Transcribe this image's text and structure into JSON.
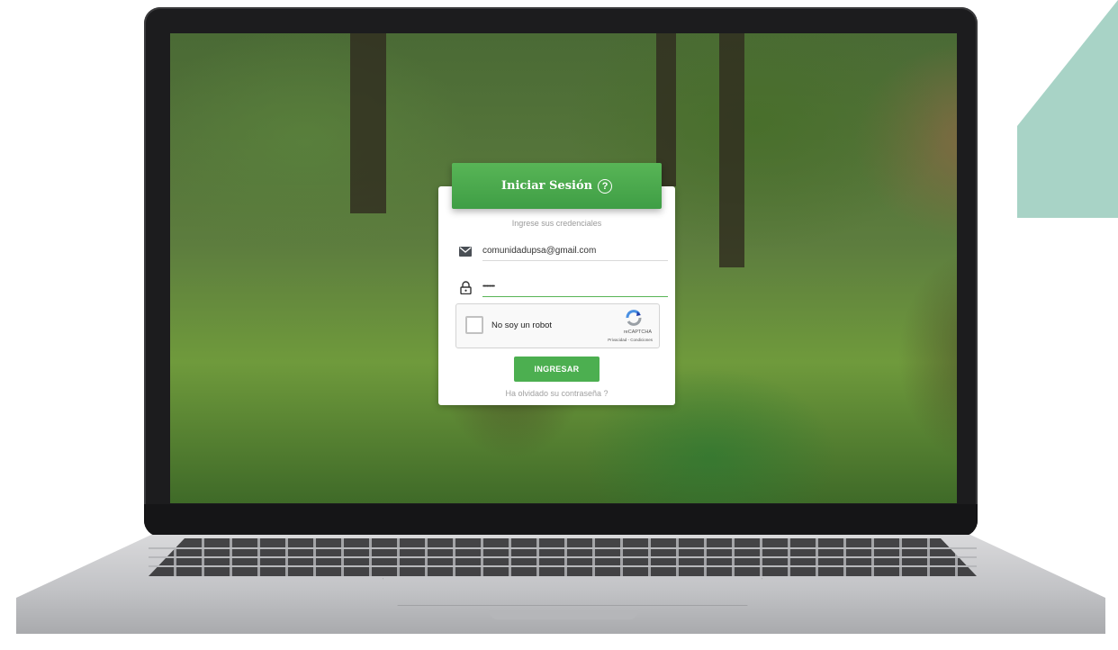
{
  "login": {
    "title": "Iniciar Sesión",
    "help_icon": "?",
    "subtitle": "Ingrese sus credenciales",
    "email_value": "comunidadupsa@gmail.com",
    "password_value": "•••••••••",
    "recaptcha": {
      "label": "No soy un robot",
      "brand": "reCAPTCHA",
      "links": "Privacidad - Condiciones"
    },
    "submit_label": "INGRESAR",
    "forgot_link": "Ha olvidado su contraseña ?"
  },
  "icons": {
    "email": "envelope-icon",
    "password": "lock-icon",
    "help": "help-circle-icon",
    "recaptcha": "recaptcha-logo-icon"
  },
  "colors": {
    "accent": "#4caf50",
    "header_gradient_top": "#58b556",
    "decor_teal": "#a8d3c6"
  }
}
